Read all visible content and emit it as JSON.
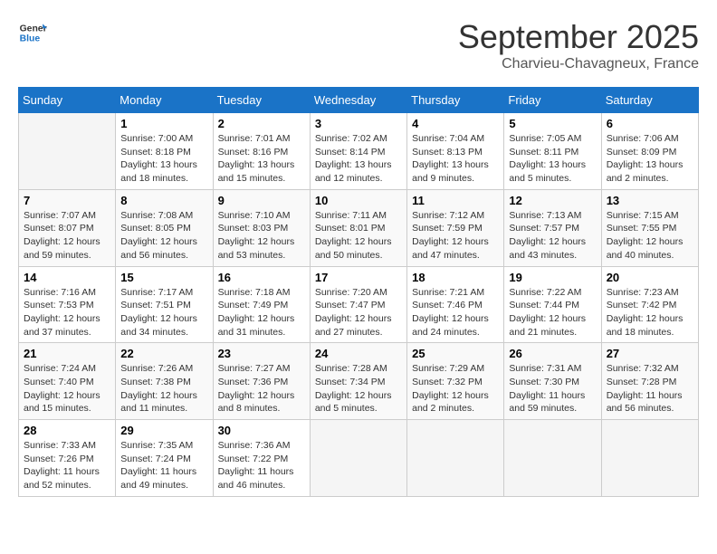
{
  "header": {
    "logo_line1": "General",
    "logo_line2": "Blue",
    "month": "September 2025",
    "location": "Charvieu-Chavagneux, France"
  },
  "days_of_week": [
    "Sunday",
    "Monday",
    "Tuesday",
    "Wednesday",
    "Thursday",
    "Friday",
    "Saturday"
  ],
  "weeks": [
    [
      {
        "day": "",
        "info": ""
      },
      {
        "day": "1",
        "info": "Sunrise: 7:00 AM\nSunset: 8:18 PM\nDaylight: 13 hours\nand 18 minutes."
      },
      {
        "day": "2",
        "info": "Sunrise: 7:01 AM\nSunset: 8:16 PM\nDaylight: 13 hours\nand 15 minutes."
      },
      {
        "day": "3",
        "info": "Sunrise: 7:02 AM\nSunset: 8:14 PM\nDaylight: 13 hours\nand 12 minutes."
      },
      {
        "day": "4",
        "info": "Sunrise: 7:04 AM\nSunset: 8:13 PM\nDaylight: 13 hours\nand 9 minutes."
      },
      {
        "day": "5",
        "info": "Sunrise: 7:05 AM\nSunset: 8:11 PM\nDaylight: 13 hours\nand 5 minutes."
      },
      {
        "day": "6",
        "info": "Sunrise: 7:06 AM\nSunset: 8:09 PM\nDaylight: 13 hours\nand 2 minutes."
      }
    ],
    [
      {
        "day": "7",
        "info": "Sunrise: 7:07 AM\nSunset: 8:07 PM\nDaylight: 12 hours\nand 59 minutes."
      },
      {
        "day": "8",
        "info": "Sunrise: 7:08 AM\nSunset: 8:05 PM\nDaylight: 12 hours\nand 56 minutes."
      },
      {
        "day": "9",
        "info": "Sunrise: 7:10 AM\nSunset: 8:03 PM\nDaylight: 12 hours\nand 53 minutes."
      },
      {
        "day": "10",
        "info": "Sunrise: 7:11 AM\nSunset: 8:01 PM\nDaylight: 12 hours\nand 50 minutes."
      },
      {
        "day": "11",
        "info": "Sunrise: 7:12 AM\nSunset: 7:59 PM\nDaylight: 12 hours\nand 47 minutes."
      },
      {
        "day": "12",
        "info": "Sunrise: 7:13 AM\nSunset: 7:57 PM\nDaylight: 12 hours\nand 43 minutes."
      },
      {
        "day": "13",
        "info": "Sunrise: 7:15 AM\nSunset: 7:55 PM\nDaylight: 12 hours\nand 40 minutes."
      }
    ],
    [
      {
        "day": "14",
        "info": "Sunrise: 7:16 AM\nSunset: 7:53 PM\nDaylight: 12 hours\nand 37 minutes."
      },
      {
        "day": "15",
        "info": "Sunrise: 7:17 AM\nSunset: 7:51 PM\nDaylight: 12 hours\nand 34 minutes."
      },
      {
        "day": "16",
        "info": "Sunrise: 7:18 AM\nSunset: 7:49 PM\nDaylight: 12 hours\nand 31 minutes."
      },
      {
        "day": "17",
        "info": "Sunrise: 7:20 AM\nSunset: 7:47 PM\nDaylight: 12 hours\nand 27 minutes."
      },
      {
        "day": "18",
        "info": "Sunrise: 7:21 AM\nSunset: 7:46 PM\nDaylight: 12 hours\nand 24 minutes."
      },
      {
        "day": "19",
        "info": "Sunrise: 7:22 AM\nSunset: 7:44 PM\nDaylight: 12 hours\nand 21 minutes."
      },
      {
        "day": "20",
        "info": "Sunrise: 7:23 AM\nSunset: 7:42 PM\nDaylight: 12 hours\nand 18 minutes."
      }
    ],
    [
      {
        "day": "21",
        "info": "Sunrise: 7:24 AM\nSunset: 7:40 PM\nDaylight: 12 hours\nand 15 minutes."
      },
      {
        "day": "22",
        "info": "Sunrise: 7:26 AM\nSunset: 7:38 PM\nDaylight: 12 hours\nand 11 minutes."
      },
      {
        "day": "23",
        "info": "Sunrise: 7:27 AM\nSunset: 7:36 PM\nDaylight: 12 hours\nand 8 minutes."
      },
      {
        "day": "24",
        "info": "Sunrise: 7:28 AM\nSunset: 7:34 PM\nDaylight: 12 hours\nand 5 minutes."
      },
      {
        "day": "25",
        "info": "Sunrise: 7:29 AM\nSunset: 7:32 PM\nDaylight: 12 hours\nand 2 minutes."
      },
      {
        "day": "26",
        "info": "Sunrise: 7:31 AM\nSunset: 7:30 PM\nDaylight: 11 hours\nand 59 minutes."
      },
      {
        "day": "27",
        "info": "Sunrise: 7:32 AM\nSunset: 7:28 PM\nDaylight: 11 hours\nand 56 minutes."
      }
    ],
    [
      {
        "day": "28",
        "info": "Sunrise: 7:33 AM\nSunset: 7:26 PM\nDaylight: 11 hours\nand 52 minutes."
      },
      {
        "day": "29",
        "info": "Sunrise: 7:35 AM\nSunset: 7:24 PM\nDaylight: 11 hours\nand 49 minutes."
      },
      {
        "day": "30",
        "info": "Sunrise: 7:36 AM\nSunset: 7:22 PM\nDaylight: 11 hours\nand 46 minutes."
      },
      {
        "day": "",
        "info": ""
      },
      {
        "day": "",
        "info": ""
      },
      {
        "day": "",
        "info": ""
      },
      {
        "day": "",
        "info": ""
      }
    ]
  ]
}
